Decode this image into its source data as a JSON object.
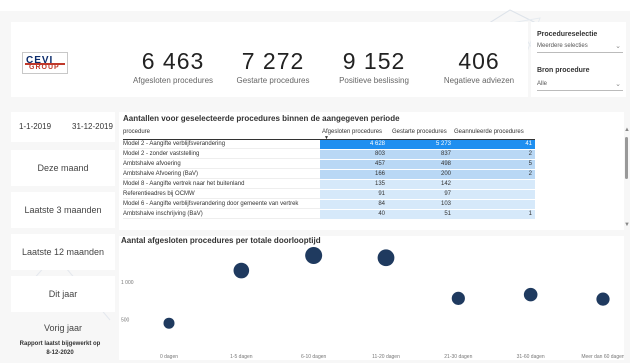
{
  "logo": {
    "line1": "CEVI",
    "line2": "GROUP"
  },
  "kpis": [
    {
      "value": "6 463",
      "label": "Afgesloten procedures"
    },
    {
      "value": "7 272",
      "label": "Gestarte procedures"
    },
    {
      "value": "9 152",
      "label": "Positieve beslissing"
    },
    {
      "value": "406",
      "label": "Negatieve adviezen"
    }
  ],
  "slicers": {
    "procedure_title": "Procedureselectie",
    "procedure_value": "Meerdere selecties",
    "source_title": "Bron procedure",
    "source_value": "Alle"
  },
  "date_range": {
    "start": "1-1-2019",
    "end": "31-12-2019"
  },
  "quick_filters": [
    "Deze maand",
    "Laatste 3 maanden",
    "Laatste 12 maanden",
    "Dit jaar",
    "Vorig jaar"
  ],
  "report_note": {
    "line1": "Rapport laatst bijgewerkt op",
    "line2": "8-12-2020"
  },
  "table": {
    "title": "Aantallen voor geselecteerde procedures binnen de aangegeven periode",
    "columns": [
      "procedure",
      "Afgesloten procedures",
      "Gestarte procedures",
      "Geannuleerde procedures"
    ],
    "rows": [
      {
        "name": "Model 2 - Aangifte verblijfsverandering",
        "afgesloten": "4 628",
        "gestart": "5 273",
        "geannuleerd": "41"
      },
      {
        "name": "Model 2 - zonder vaststelling",
        "afgesloten": "803",
        "gestart": "837",
        "geannuleerd": "2"
      },
      {
        "name": "Ambtshalve afvoering",
        "afgesloten": "457",
        "gestart": "498",
        "geannuleerd": "5"
      },
      {
        "name": "Ambtshalve Afvoering (BaV)",
        "afgesloten": "166",
        "gestart": "200",
        "geannuleerd": "2"
      },
      {
        "name": "Model 8 - Aangifte vertrek naar het buitenland",
        "afgesloten": "135",
        "gestart": "142",
        "geannuleerd": ""
      },
      {
        "name": "Referentieadres bij OCMW",
        "afgesloten": "91",
        "gestart": "97",
        "geannuleerd": ""
      },
      {
        "name": "Model 6 - Aangifte verblijfsverandering door gemeente van vertrek",
        "afgesloten": "84",
        "gestart": "103",
        "geannuleerd": ""
      },
      {
        "name": "Ambtshalve inschrijving (BaV)",
        "afgesloten": "40",
        "gestart": "51",
        "geannuleerd": "1"
      }
    ]
  },
  "chart_data": {
    "type": "scatter",
    "title": "Aantal afgesloten procedures per totale doorlooptijd",
    "categories": [
      "0 dagen",
      "1-5 dagen",
      "6-10 dagen",
      "11-20 dagen",
      "21-30 dagen",
      "31-60 dagen",
      "Meer dan 60 dagen"
    ],
    "values": [
      450,
      1150,
      1350,
      1320,
      780,
      830,
      770
    ],
    "yticks": [
      "500",
      "1 000"
    ],
    "ylim": [
      200,
      1450
    ],
    "grid": false
  },
  "colors": {
    "dot": "#1f3a5f",
    "bar_strong": "#1f8ff0",
    "bar_light": "#d6e9fa",
    "bar_mid": "#b9d8f5"
  }
}
